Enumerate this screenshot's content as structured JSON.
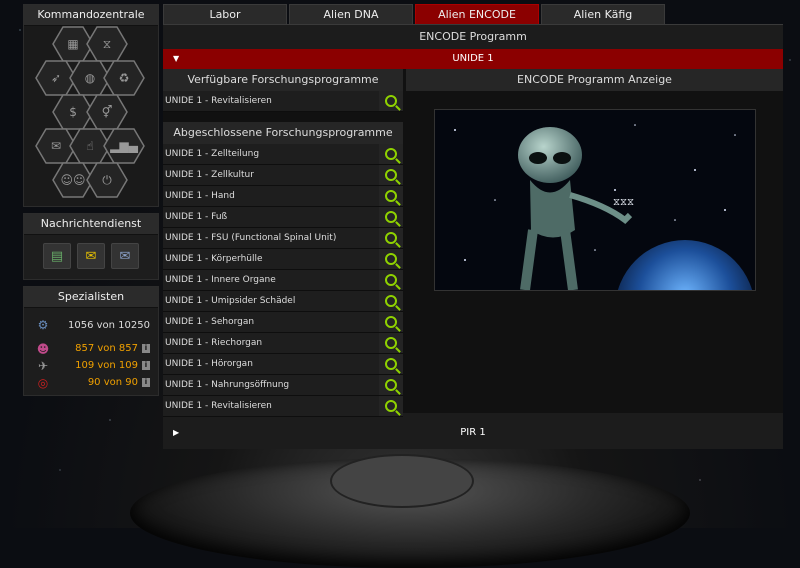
{
  "sidebar": {
    "kommandozentrale_title": "Kommandozentrale",
    "hex_icons": [
      "factory-icon",
      "dna-icon",
      "rocket-icon",
      "globe-icon",
      "recycle-icon",
      "coins-icon",
      "gender-icon",
      "mail-icon",
      "thumbs-up-icon",
      "podium-icon",
      "family-icon",
      "power-icon"
    ],
    "nachrichtendienst_title": "Nachrichtendienst",
    "message_icons": [
      "document-icon",
      "envelope-icon",
      "mailbox-icon"
    ],
    "spezialisten_title": "Spezialisten",
    "specialists": [
      {
        "icon": "robot-icon",
        "value": "1056 von 10250",
        "highlight": false,
        "info": false
      },
      {
        "icon": "people-icon",
        "value": "857 von 857",
        "highlight": true,
        "info": true
      },
      {
        "icon": "plane-icon",
        "value": "109 von 109",
        "highlight": true,
        "info": true
      },
      {
        "icon": "target-icon",
        "value": "90 von 90",
        "highlight": true,
        "info": true
      }
    ],
    "info_label": "i"
  },
  "tabs": [
    {
      "label": "Labor",
      "active": false
    },
    {
      "label": "Alien DNA",
      "active": false
    },
    {
      "label": "Alien ENCODE",
      "active": true
    },
    {
      "label": "Alien Käfig",
      "active": false
    }
  ],
  "main": {
    "section_title": "ENCODE Programm",
    "open_group": "UNIDE 1",
    "closed_group": "PIR 1",
    "available_header": "Verfügbare Forschungsprogramme",
    "available": [
      "UNIDE 1 - Revitalisieren"
    ],
    "completed_header": "Abgeschlossene Forschungsprogramme",
    "completed": [
      "UNIDE 1 - Zellteilung",
      "UNIDE 1 - Zellkultur",
      "UNIDE 1 - Hand",
      "UNIDE 1 - Fuß",
      "UNIDE 1 - FSU (Functional Spinal Unit)",
      "UNIDE 1 - Körperhülle",
      "UNIDE 1 - Innere Organe",
      "UNIDE 1 - Umipsider Schädel",
      "UNIDE 1 - Sehorgan",
      "UNIDE 1 - Riechorgan",
      "UNIDE 1 - Hörorgan",
      "UNIDE 1 - Nahrungsöffnung",
      "UNIDE 1 - Revitalisieren"
    ],
    "display_header": "ENCODE Programm Anzeige"
  },
  "colors": {
    "accent": "#8b0000",
    "magnifier": "#8fd200",
    "highlight": "#f0a000"
  }
}
